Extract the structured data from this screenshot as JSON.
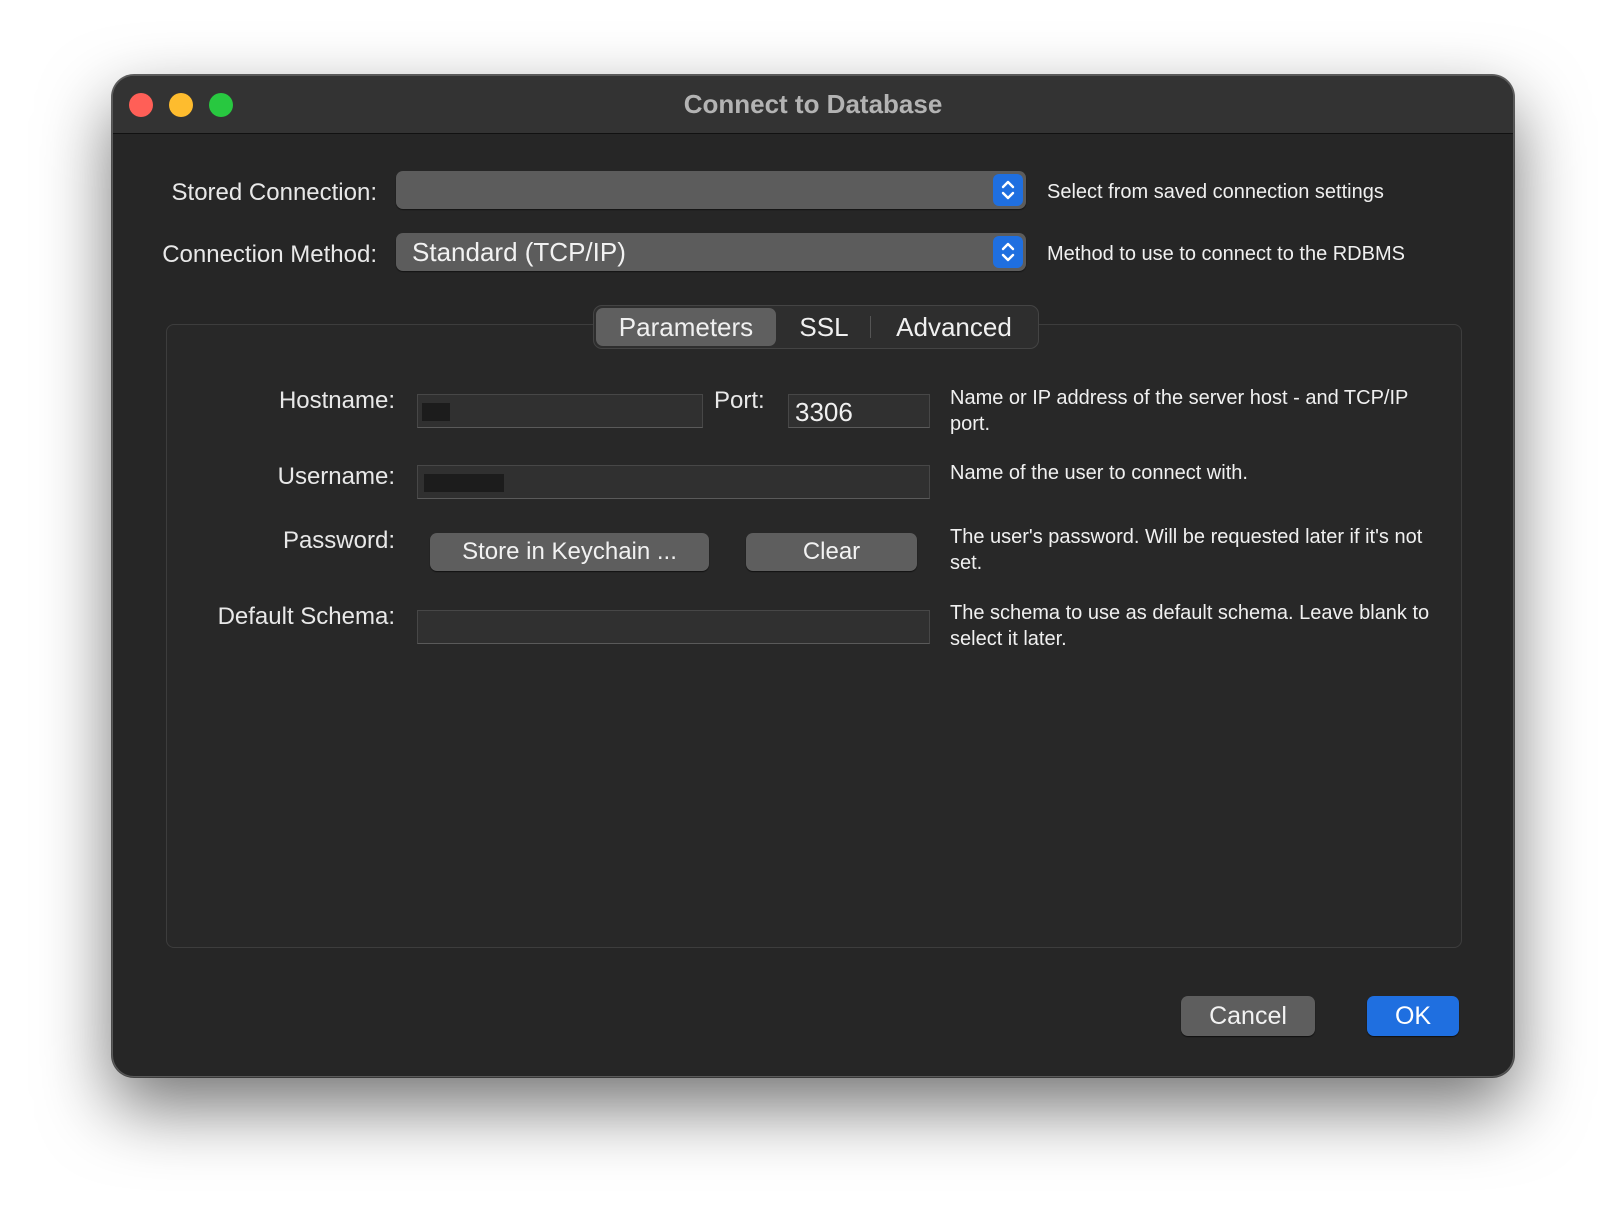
{
  "window": {
    "title": "Connect to Database"
  },
  "stored_connection": {
    "label": "Stored Connection:",
    "value": "",
    "hint": "Select from saved connection settings"
  },
  "connection_method": {
    "label": "Connection Method:",
    "value": "Standard (TCP/IP)",
    "hint": "Method to use to connect to the RDBMS"
  },
  "tabs": [
    {
      "label": "Parameters",
      "selected": true
    },
    {
      "label": "SSL",
      "selected": false
    },
    {
      "label": "Advanced",
      "selected": false
    }
  ],
  "parameters": {
    "hostname_label": "Hostname:",
    "hostname_value": "",
    "port_label": "Port:",
    "port_value": "3306",
    "hostname_hint": "Name or IP address of the server host - and TCP/IP port.",
    "username_label": "Username:",
    "username_value": "",
    "username_hint": "Name of the user to connect with.",
    "password_label": "Password:",
    "store_keychain_label": "Store in Keychain ...",
    "clear_label": "Clear",
    "password_hint": "The user's password. Will be requested later if it's not set.",
    "schema_label": "Default Schema:",
    "schema_value": "",
    "schema_hint": "The schema to use as default schema. Leave blank to select it later."
  },
  "footer": {
    "cancel_label": "Cancel",
    "ok_label": "OK"
  },
  "colors": {
    "accent": "#1f6fe0",
    "window_bg": "#262626",
    "titlebar_bg": "#333333",
    "close": "#ff5f57",
    "minimize": "#febc2e",
    "maximize": "#28c840"
  },
  "icons": {
    "popup_stepper": "chevron-up-down-icon"
  }
}
